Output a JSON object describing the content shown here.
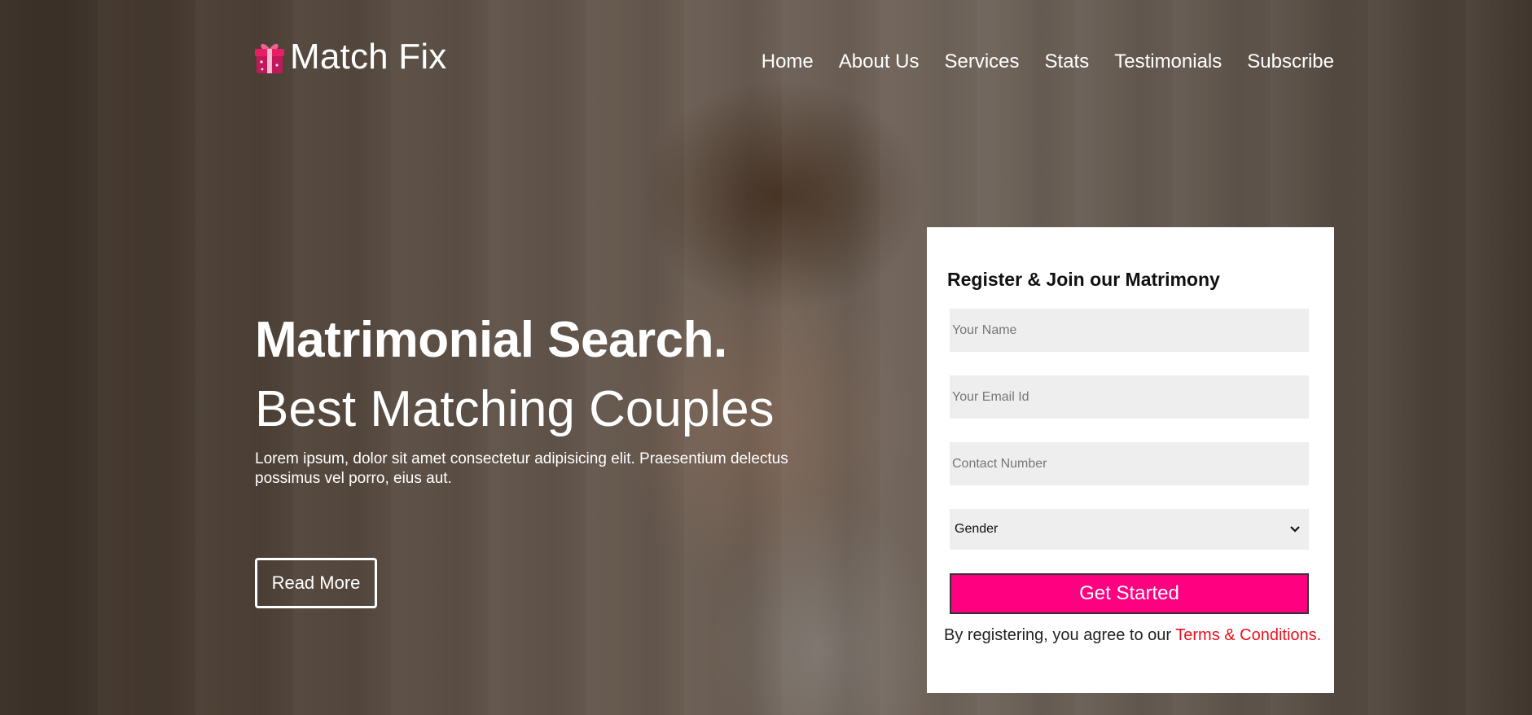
{
  "brand": {
    "name": "Match Fix",
    "icon": "gift-icon",
    "accent_color": "#ff0080"
  },
  "nav": {
    "items": [
      {
        "label": "Home"
      },
      {
        "label": "About Us"
      },
      {
        "label": "Services"
      },
      {
        "label": "Stats"
      },
      {
        "label": "Testimonials"
      },
      {
        "label": "Subscribe"
      }
    ]
  },
  "hero": {
    "title": "Matrimonial Search.",
    "subtitle": "Best Matching Couples",
    "description": "Lorem ipsum, dolor sit amet consectetur adipisicing elit. Praesentium delectus possimus vel porro, eius aut.",
    "read_more_label": "Read More"
  },
  "register_form": {
    "title": "Register & Join our Matrimony",
    "name_placeholder": "Your Name",
    "email_placeholder": "Your Email Id",
    "contact_placeholder": "Contact Number",
    "gender_selected": "Gender",
    "submit_label": "Get Started",
    "terms_prefix": "By registering, you agree to our",
    "terms_link": "Terms & Conditions.",
    "terms_color": "#e8101d"
  }
}
